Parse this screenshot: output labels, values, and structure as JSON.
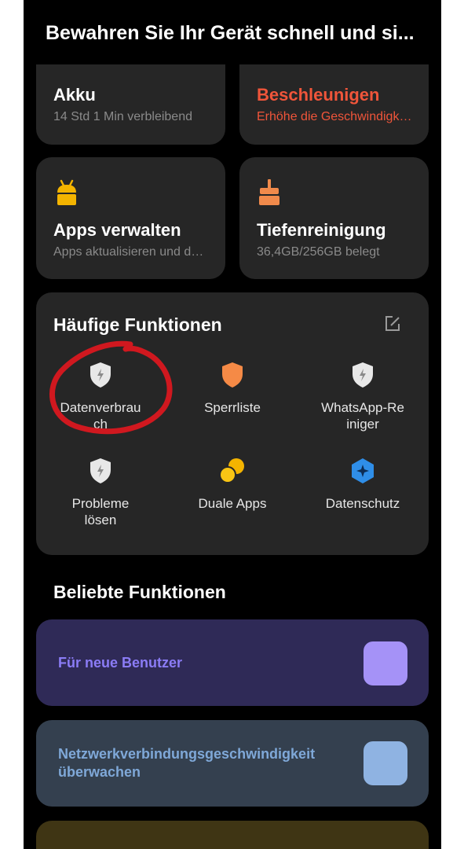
{
  "header": {
    "title": "Bewahren Sie Ihr Gerät schnell und si..."
  },
  "top_cards": [
    {
      "title": "Akku",
      "subtitle": "14 Std 1 Min  verbleibend",
      "icon": "battery-icon",
      "color": "#2fbf71"
    },
    {
      "title": "Beschleunigen",
      "subtitle": "Erhöhe die Geschwindigkei...",
      "icon": "rocket-icon",
      "color": "#f0553a"
    }
  ],
  "mid_cards": [
    {
      "title": "Apps verwalten",
      "subtitle": "Apps aktualisieren und dei...",
      "icon": "android-icon",
      "color": "#f4b400"
    },
    {
      "title": "Tiefenreinigung",
      "subtitle": "36,4GB/256GB belegt",
      "icon": "broom-icon",
      "color": "#f08a4b"
    }
  ],
  "frequent": {
    "title": "Häufige Funktionen",
    "items": [
      {
        "label": "Datenverbrau\nch",
        "icon": "shield-bolt-icon"
      },
      {
        "label": "Sperrliste",
        "icon": "shield-block-icon"
      },
      {
        "label": "WhatsApp-Re\niniger",
        "icon": "shield-clean-icon"
      },
      {
        "label": "Probleme\nlösen",
        "icon": "shield-fix-icon"
      },
      {
        "label": "Duale Apps",
        "icon": "dual-apps-icon"
      },
      {
        "label": "Datenschutz",
        "icon": "privacy-icon"
      }
    ]
  },
  "popular": {
    "title": "Beliebte Funktionen",
    "items": [
      {
        "label": "Für neue Benutzer",
        "bg": "#2f2a57",
        "text_color": "#8b7cf6",
        "thumb": "#a592f7"
      },
      {
        "label": "Netzwerkverbindungsgeschwindigkeit\nüberwachen",
        "bg": "#34404f",
        "text_color": "#7fa8d8",
        "thumb": "#8fb3e2"
      }
    ]
  },
  "colors": {
    "background": "#000000",
    "card": "#262626",
    "accent_red": "#f0553a",
    "annotation": "#d0181f"
  }
}
